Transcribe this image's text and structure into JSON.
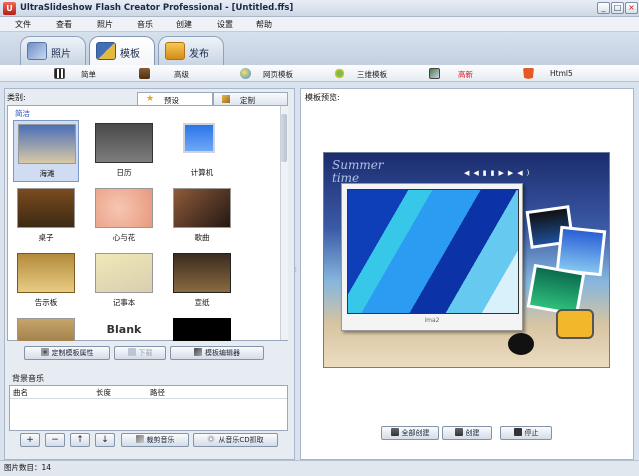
{
  "window": {
    "title": "UltraSlideshow Flash Creator Professional - [Untitled.ffs]",
    "controls": [
      "_",
      "□",
      "×"
    ]
  },
  "menu": [
    "文件",
    "查看",
    "照片",
    "音乐",
    "创建",
    "设置",
    "帮助"
  ],
  "main_tabs": [
    {
      "label": "照片",
      "icon": "photo-icon"
    },
    {
      "label": "模板",
      "icon": "template-icon"
    },
    {
      "label": "发布",
      "icon": "publish-icon"
    }
  ],
  "sub_toolbar": [
    {
      "label": "简单",
      "icon": "piano-icon"
    },
    {
      "label": "高级",
      "icon": "briefcase-icon"
    },
    {
      "label": "网页模板",
      "icon": "web-icon"
    },
    {
      "label": "三维模板",
      "icon": "3d-icon"
    },
    {
      "label": "高新",
      "icon": "image-icon",
      "color": "#d4141a"
    },
    {
      "label": "Html5",
      "icon": "html5-icon"
    }
  ],
  "left": {
    "category_label": "类别:",
    "category_tabs": [
      "预设",
      "定制"
    ],
    "group_title": "简洁",
    "templates": [
      {
        "name": "海滩",
        "selected": true
      },
      {
        "name": "日历"
      },
      {
        "name": "计算机"
      },
      {
        "name": "桌子"
      },
      {
        "name": "心与花"
      },
      {
        "name": "歌曲"
      },
      {
        "name": "告示板"
      },
      {
        "name": "记事本"
      },
      {
        "name": "宣纸"
      },
      {
        "name": ""
      },
      {
        "name": "Blank"
      },
      {
        "name": ""
      }
    ],
    "buttons": [
      {
        "label": "定制模板属性",
        "enabled": true
      },
      {
        "label": "下载",
        "enabled": false
      },
      {
        "label": "模板编辑器",
        "enabled": true
      }
    ],
    "music_label": "背景音乐",
    "music_columns": [
      "曲名",
      "长度",
      "路径"
    ],
    "music_buttons": [
      "+",
      "−",
      "↑",
      "↓"
    ],
    "music_text_buttons": [
      "裁剪音乐",
      "从音乐CD抓取"
    ]
  },
  "right": {
    "preview_label": "模板预览:",
    "preview_caption": "Summer time",
    "photo_caption": "ima2",
    "buttons": [
      "全部创建",
      "创建",
      "停止"
    ]
  },
  "status": {
    "text": "图片数目：14"
  }
}
